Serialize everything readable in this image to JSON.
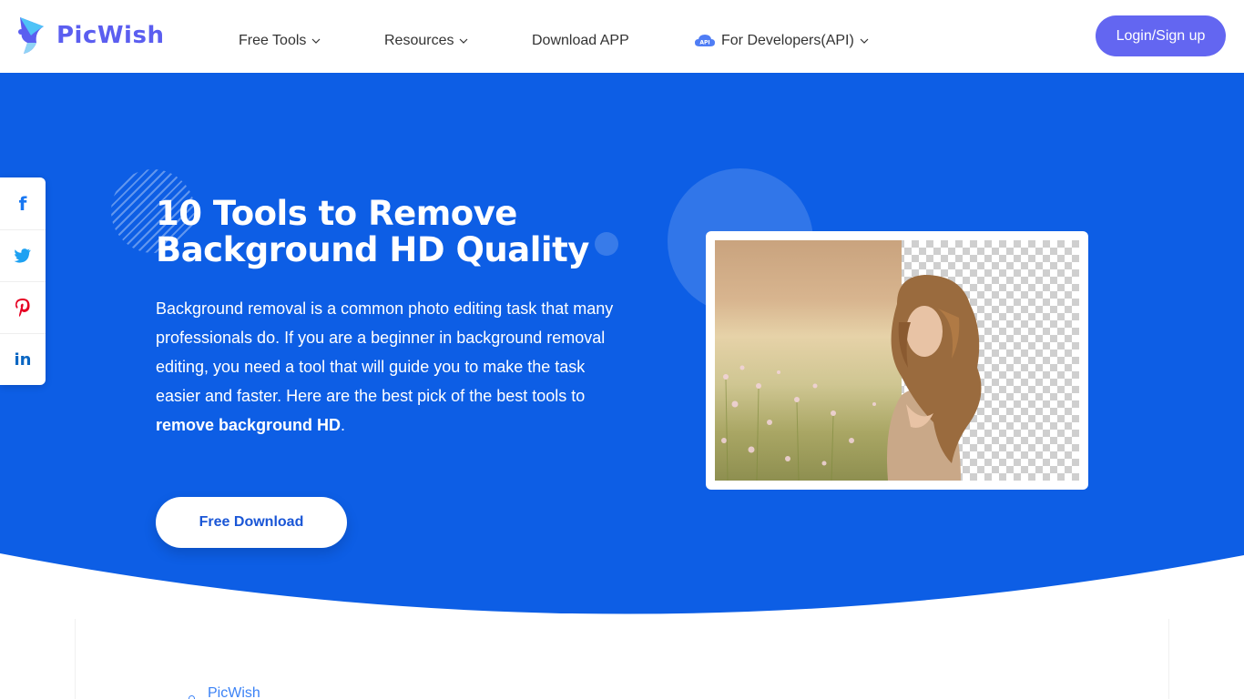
{
  "brand": {
    "name": "PicWish",
    "color": "#5b5ef0"
  },
  "nav": {
    "items": [
      {
        "label": "Free Tools",
        "dropdown": true
      },
      {
        "label": "Resources",
        "dropdown": true
      },
      {
        "label": "Download APP",
        "dropdown": false
      },
      {
        "label": "For Developers(API)",
        "dropdown": true,
        "badge": "API"
      }
    ],
    "login_label": "Login/Sign up"
  },
  "hero": {
    "title_line1": "10 Tools to Remove",
    "title_line2": "Background HD Quality",
    "description": "Background removal is a common photo editing task that many professionals do. If you are a beginner in background removal editing, you need a tool that will guide you to make the task easier and faster. Here are the best pick of the best tools to ",
    "description_bold": "remove background HD",
    "description_end": ".",
    "cta_label": "Free Download",
    "bg_color": "#0d5ee5"
  },
  "social": {
    "items": [
      {
        "icon": "facebook-icon",
        "glyph": "f",
        "color": "#1877f2"
      },
      {
        "icon": "twitter-icon",
        "glyph": "twitter",
        "color": "#1da1f2"
      },
      {
        "icon": "pinterest-icon",
        "glyph": "P",
        "color": "#e60023"
      },
      {
        "icon": "linkedin-icon",
        "glyph": "in",
        "color": "#0a66c2"
      }
    ]
  },
  "toc": {
    "first_item": "PicWish"
  }
}
